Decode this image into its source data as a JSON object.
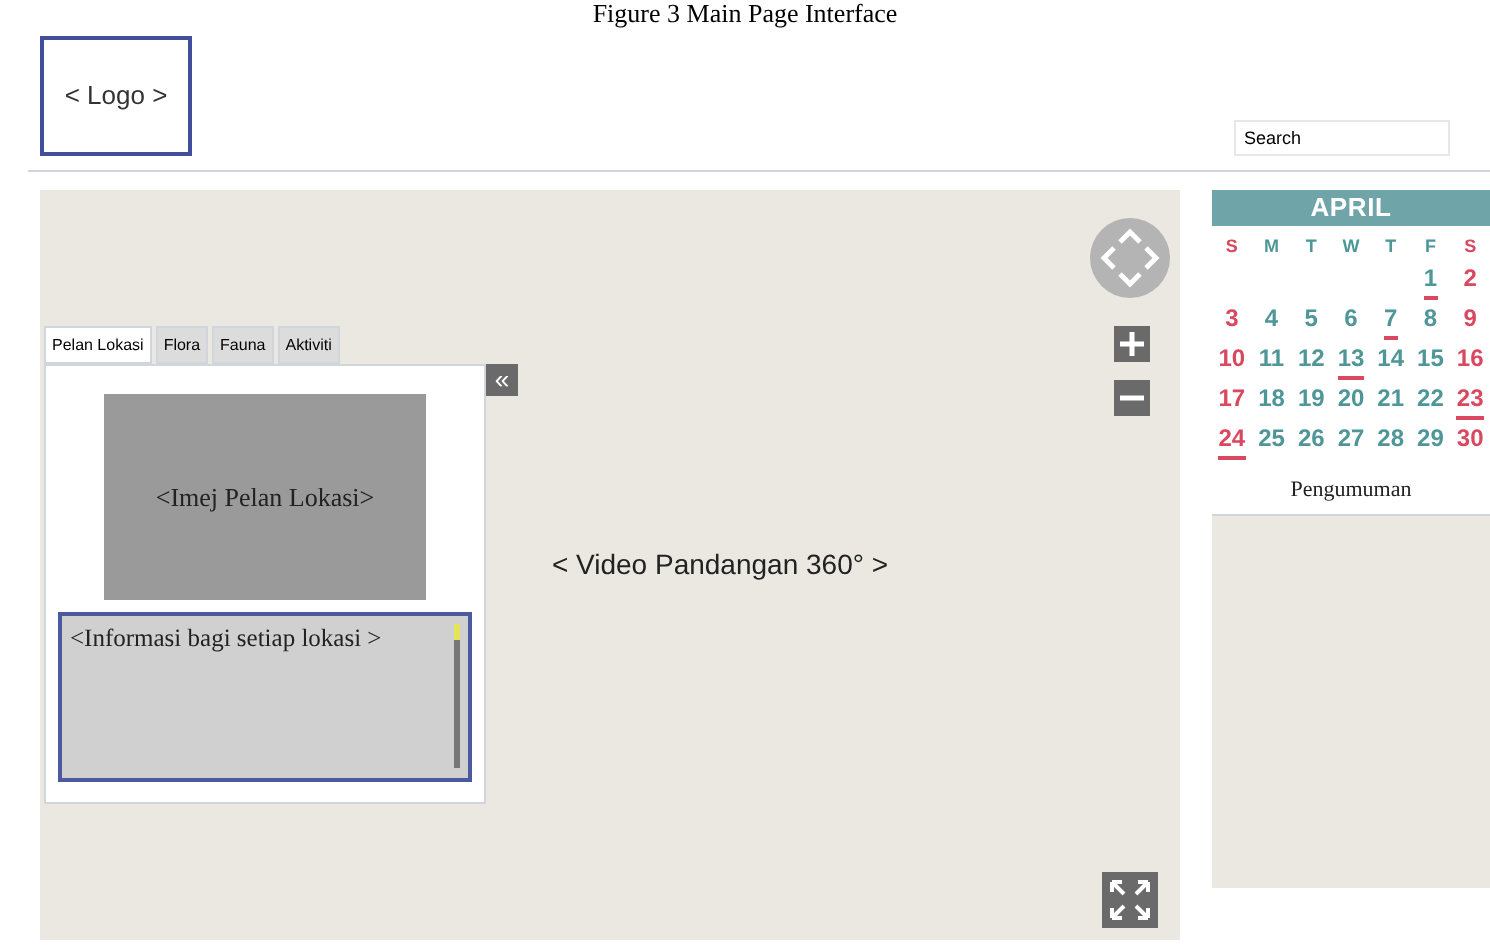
{
  "caption": "Figure 3 Main Page Interface",
  "header": {
    "logo": "< Logo >",
    "search": {
      "placeholder": "Search"
    }
  },
  "map": {
    "tabs": [
      {
        "label": "Pelan Lokasi",
        "selected": true
      },
      {
        "label": "Flora",
        "selected": false
      },
      {
        "label": "Fauna",
        "selected": false
      },
      {
        "label": "Aktiviti",
        "selected": false
      }
    ],
    "collapse": "«",
    "image": "<Imej Pelan Lokasi>",
    "info": "<Informasi bagi setiap lokasi >",
    "video": "< Video Pandangan 360° >"
  },
  "calendar": {
    "month": "APRIL",
    "columns": [
      {
        "label": "S",
        "color": "#d9485f"
      },
      {
        "label": "M",
        "color": "#4f9699"
      },
      {
        "label": "T",
        "color": "#4f9699"
      },
      {
        "label": "W",
        "color": "#4f9699"
      },
      {
        "label": "T",
        "color": "#4f9699"
      },
      {
        "label": "F",
        "color": "#4f9699"
      },
      {
        "label": "S",
        "color": "#d9485f"
      }
    ],
    "weeks": [
      [
        {
          "day": "1",
          "marked": true
        },
        {
          "day": "2",
          "marked": false
        }
      ],
      [
        {
          "day": "3",
          "marked": false
        },
        {
          "day": "4",
          "marked": false
        },
        {
          "day": "5",
          "marked": false
        },
        {
          "day": "6",
          "marked": false
        },
        {
          "day": "7",
          "marked": true
        },
        {
          "day": "8",
          "marked": false
        },
        {
          "day": "9",
          "marked": false
        }
      ],
      [
        {
          "day": "10",
          "marked": false
        },
        {
          "day": "11",
          "marked": false
        },
        {
          "day": "12",
          "marked": false
        },
        {
          "day": "13",
          "marked": true
        },
        {
          "day": "14",
          "marked": false
        },
        {
          "day": "15",
          "marked": false
        },
        {
          "day": "16",
          "marked": false
        }
      ],
      [
        {
          "day": "17",
          "marked": false
        },
        {
          "day": "18",
          "marked": false
        },
        {
          "day": "19",
          "marked": false
        },
        {
          "day": "20",
          "marked": false
        },
        {
          "day": "21",
          "marked": false
        },
        {
          "day": "22",
          "marked": false
        },
        {
          "day": "23",
          "marked": true
        }
      ],
      [
        {
          "day": "24",
          "marked": true
        },
        {
          "day": "25",
          "marked": false
        },
        {
          "day": "26",
          "marked": false
        },
        {
          "day": "27",
          "marked": false
        },
        {
          "day": "28",
          "marked": false
        },
        {
          "day": "29",
          "marked": false
        },
        {
          "day": "30",
          "marked": false
        }
      ]
    ]
  },
  "announcements": {
    "title": "Pengumuman"
  }
}
